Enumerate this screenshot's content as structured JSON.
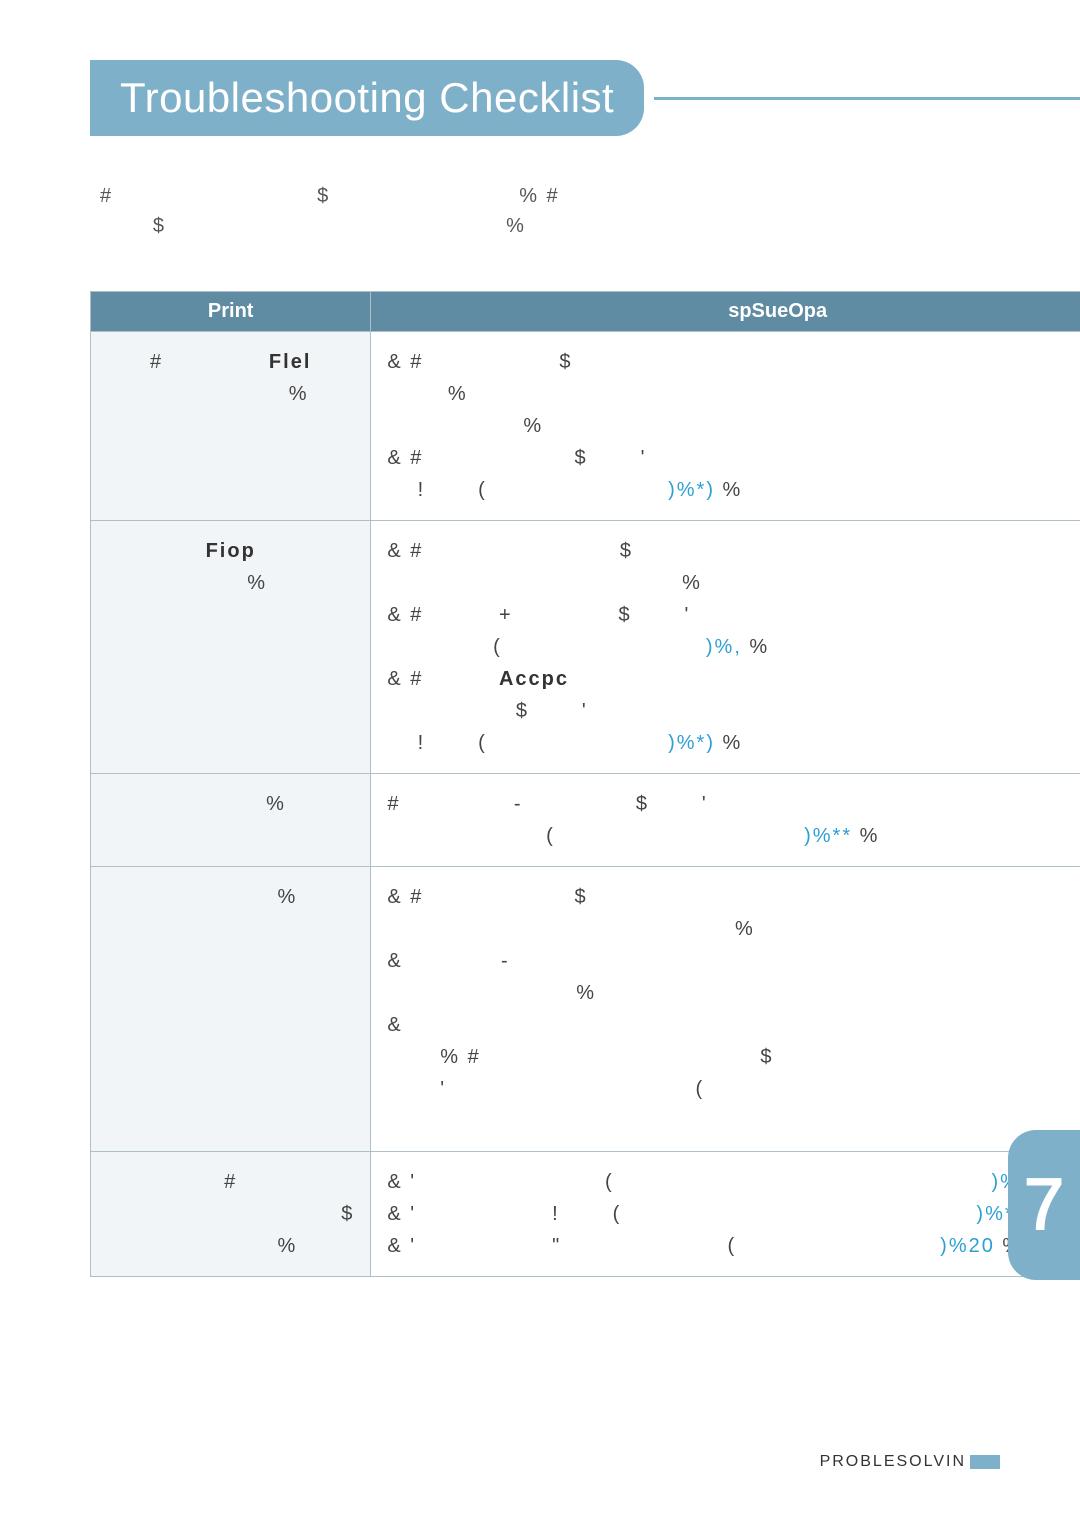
{
  "title": "Troubleshooting Checklist",
  "intro": "#                           $                         % #\n       $                                             %",
  "table": {
    "headers": [
      "Print",
      "spSueOpa"
    ],
    "rows": [
      {
        "problem": "#              Flel\n                  %",
        "solution": "& #                  $\n        %\n                  %\n& #                    $       '\n    !       (                        )%*) %"
      },
      {
        "problem": "Fiop\n       %",
        "solution": "& #                          $\n                                       %\n& #          +              $       '\n              (                           )%, %\n& #          Accpc\n                 $       '\n    !       (                        )%*) %"
      },
      {
        "problem": "\n            %",
        "solution": "#               -               $       '\n                     (                                 )%** %"
      },
      {
        "problem": "\n\n\n               %",
        "solution": "& #                    $\n                                              %\n&             -\n                         %\n&\n\n       % #                                     $\n       '                                 (                                                     )%. %\n "
      },
      {
        "problem": "#\n                               $\n\n               %",
        "solution": "& '                         (                                                  )%. %\n& '                  !       (                                               )%*) %\n& '                  \"                      (                           )%20 %"
      }
    ]
  },
  "sideTabNumber": "7",
  "footer": "PROBLESOLVIN"
}
